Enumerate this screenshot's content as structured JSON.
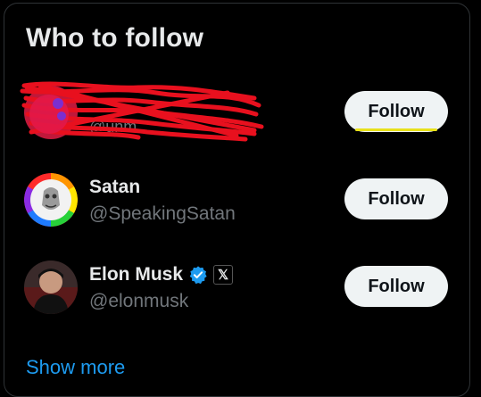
{
  "widget": {
    "title": "Who to follow",
    "show_more": "Show more"
  },
  "accounts": [
    {
      "name": "",
      "handle": "@unm",
      "follow_label": "Follow",
      "redacted": true
    },
    {
      "name": "Satan",
      "handle": "@SpeakingSatan",
      "follow_label": "Follow"
    },
    {
      "name": "Elon Musk",
      "handle": "@elonmusk",
      "follow_label": "Follow",
      "verified": true,
      "affiliate_badge": "𝕏"
    }
  ],
  "colors": {
    "background": "#000000",
    "text_primary": "#e7e9ea",
    "text_secondary": "#71767b",
    "link": "#1d9bf0",
    "button_bg": "#eff3f4",
    "verified_badge": "#1d9bf0",
    "redaction_scribble": "#e8101e",
    "highlight_underline": "#e8e11a"
  }
}
